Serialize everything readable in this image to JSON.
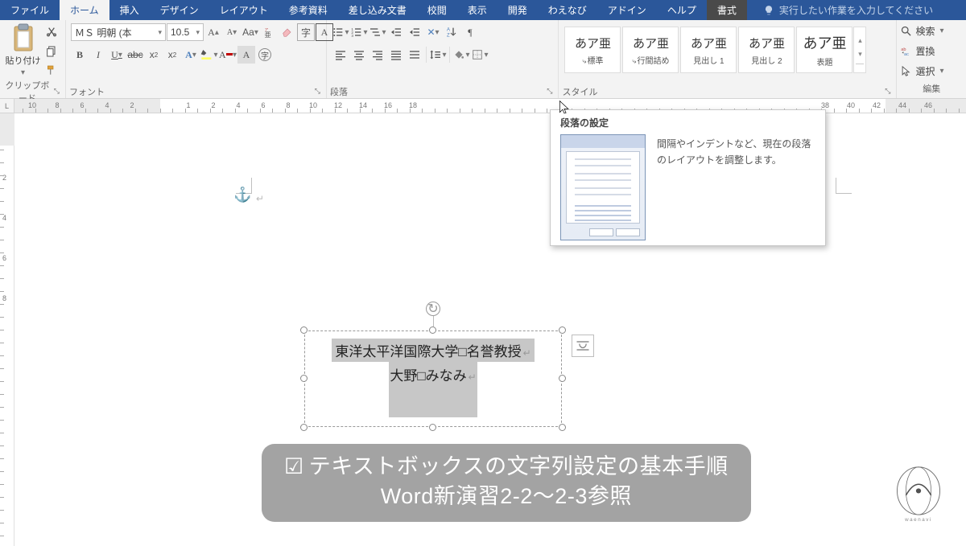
{
  "tabs": {
    "file": "ファイル",
    "home": "ホーム",
    "insert": "挿入",
    "design": "デザイン",
    "layout": "レイアウト",
    "references": "参考資料",
    "mailings": "差し込み文書",
    "review": "校閲",
    "view": "表示",
    "developer": "開発",
    "waenabi": "わえなび",
    "addins": "アドイン",
    "help": "ヘルプ",
    "format": "書式",
    "tellme": "実行したい作業を入力してください"
  },
  "clipboard": {
    "paste": "貼り付け",
    "group_label": "クリップボード"
  },
  "font": {
    "name": "ＭＳ 明朝 (本",
    "size": "10.5",
    "group_label": "フォント"
  },
  "paragraph": {
    "group_label": "段落"
  },
  "styles": {
    "sample": "あア亜",
    "items": [
      "標準",
      "行間詰め",
      "見出し 1",
      "見出し 2",
      "表題"
    ],
    "group_label": "スタイル"
  },
  "editing": {
    "find": "検索",
    "replace": "置換",
    "select": "選択",
    "group_label": "編集"
  },
  "ruler_h": {
    "nums": [
      "10",
      "8",
      "6",
      "4",
      "2",
      "1",
      "2",
      "4",
      "6",
      "8",
      "10",
      "12",
      "14",
      "16",
      "18",
      "38",
      "40",
      "42",
      "44",
      "46"
    ]
  },
  "ruler_v": {
    "nums": [
      "2",
      "4",
      "6",
      "8"
    ]
  },
  "textbox": {
    "line1": "東洋太平洋国際大学□名誉教授",
    "line2": "大野□みなみ"
  },
  "tooltip": {
    "title": "段落の設定",
    "desc": "間隔やインデントなど、現在の段落のレイアウトを調整します。"
  },
  "caption": {
    "line1": "テキストボックスの文字列設定の基本手順",
    "line2": "Word新演習2-2～2-3参照"
  },
  "corner": "L"
}
